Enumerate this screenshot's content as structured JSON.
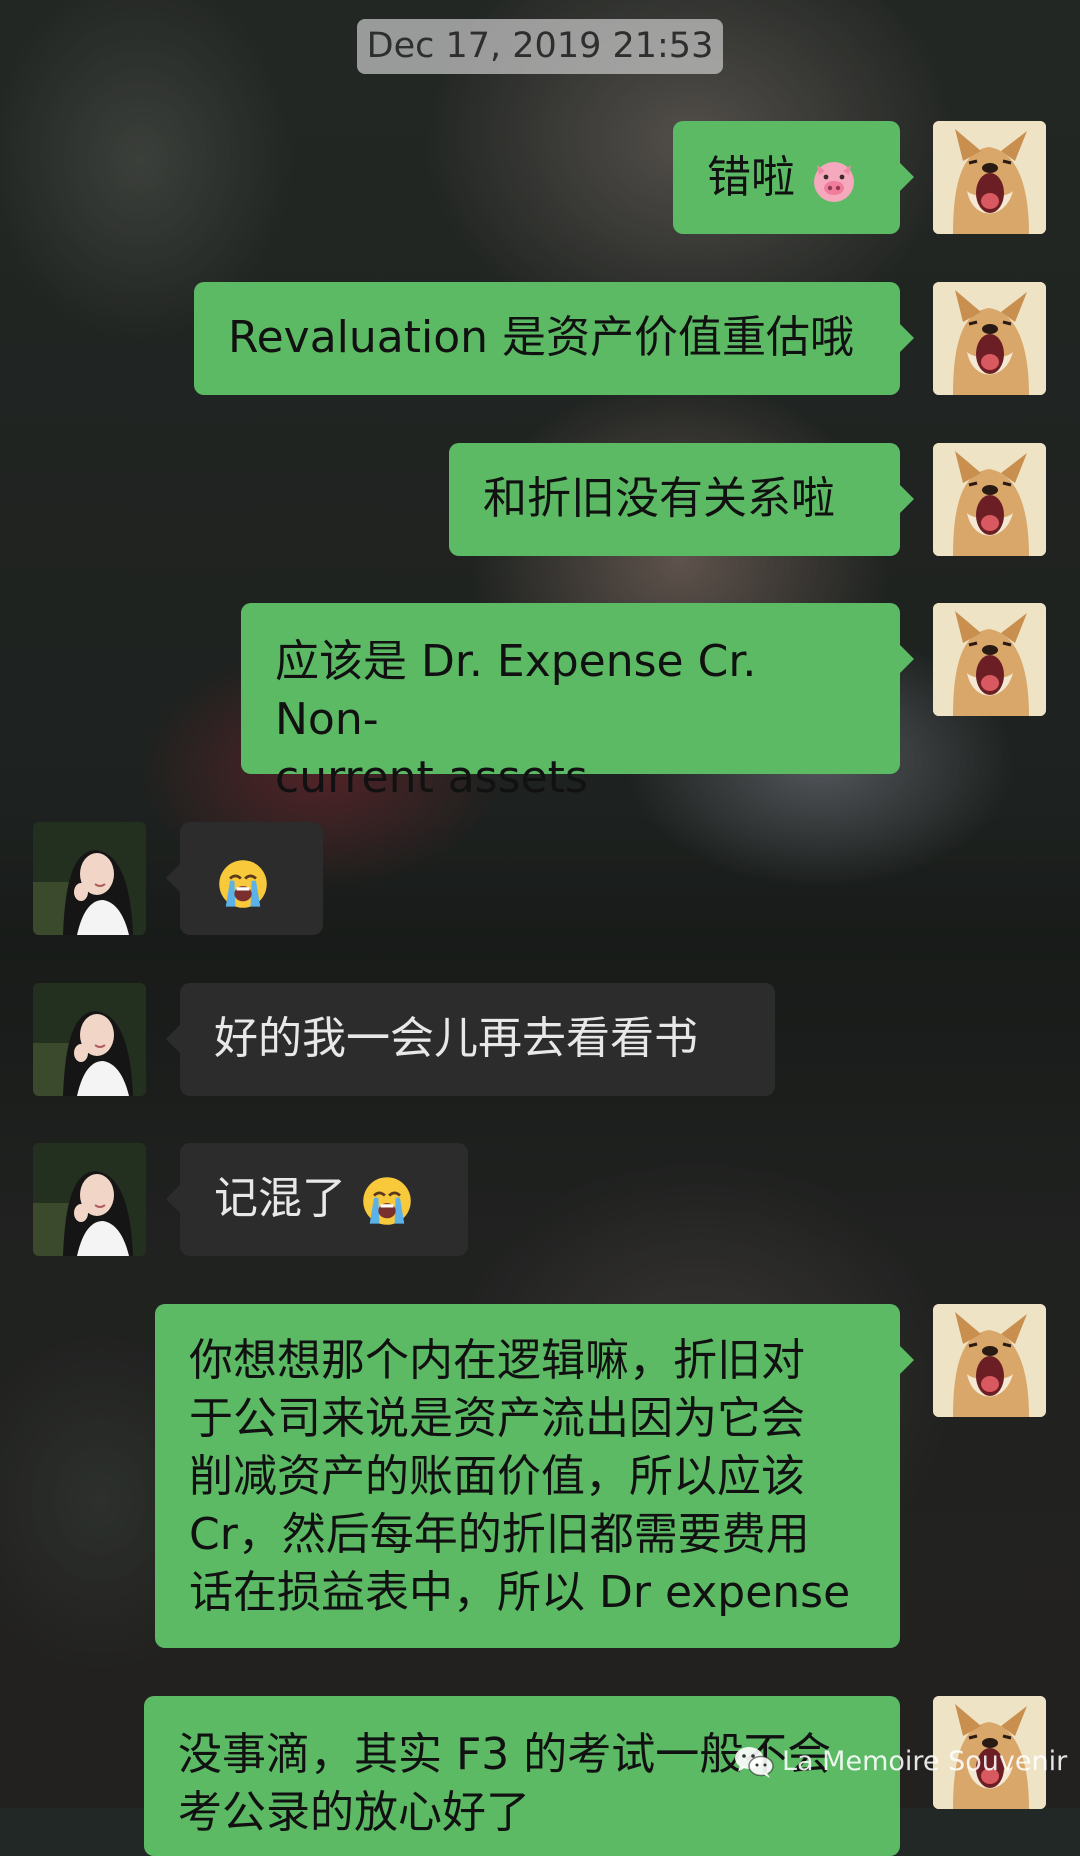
{
  "timestamp": "Dec 17, 2019 21:53",
  "messages": [
    {
      "side": "out",
      "text": "错啦",
      "emoji": "pig-face"
    },
    {
      "side": "out",
      "text": "Revaluation 是资产价值重估哦"
    },
    {
      "side": "out",
      "text": "和折旧没有关系啦"
    },
    {
      "side": "out",
      "text": "应该是 Dr. Expense Cr. Non-\ncurrent assets"
    },
    {
      "side": "in",
      "text": "",
      "emoji": "loudly-crying-face"
    },
    {
      "side": "in",
      "text": "好的我一会儿再去看看书"
    },
    {
      "side": "in",
      "text": "记混了",
      "emoji": "loudly-crying-face"
    },
    {
      "side": "out",
      "text": "你想想那个内在逻辑嘛，折旧对\n于公司来说是资产流出因为它会\n削减资产的账面价值，所以应该\nCr，然后每年的折旧都需要费用\n话在损益表中，所以 Dr expense"
    },
    {
      "side": "out",
      "text": "没事滴，其实 F3 的考试一般不会\n考公录的放心好了"
    }
  ],
  "watermark": {
    "icon": "wechat-icon",
    "text": "La Memoire Souvenir"
  },
  "colors": {
    "outgoing_bubble": "#5cba65",
    "incoming_bubble": "#2c2c2c",
    "timestamp_bg": "#c8c8c8"
  }
}
